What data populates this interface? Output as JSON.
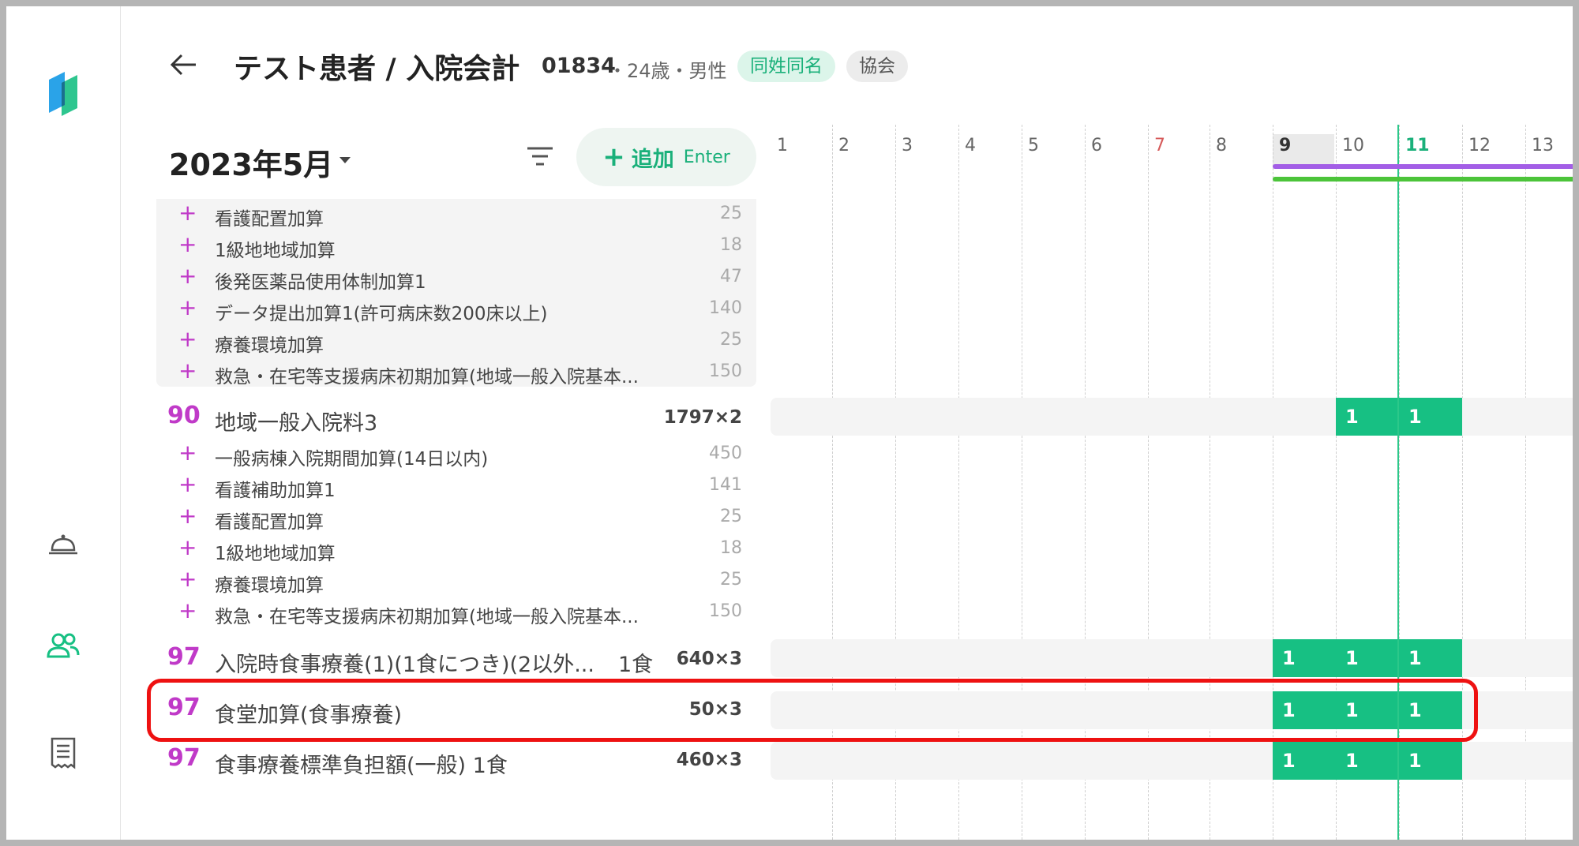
{
  "header": {
    "title": "テスト患者 / 入院会計",
    "patient_id": "01834",
    "patient_meta": "・24歳・男性",
    "badges": [
      "同姓同名",
      "協会"
    ]
  },
  "toolbar": {
    "month": "2023年5月",
    "add_label": "追加",
    "add_key": "Enter"
  },
  "sidebar": {
    "icons": [
      "app-logo-icon",
      "bell-icon",
      "users-icon",
      "receipt-icon"
    ]
  },
  "calendar": {
    "days": [
      "1",
      "2",
      "3",
      "4",
      "5",
      "6",
      "7",
      "8",
      "9",
      "10",
      "11",
      "12",
      "13"
    ],
    "selected_day": "9",
    "today": "11",
    "holiday_day": "7"
  },
  "rows": [
    {
      "type": "sub",
      "plus": "+",
      "name": "看護配置加算",
      "val": "25"
    },
    {
      "type": "sub",
      "plus": "+",
      "name": "1級地地域加算",
      "val": "18"
    },
    {
      "type": "sub",
      "plus": "+",
      "name": "後発医薬品使用体制加算1",
      "val": "47"
    },
    {
      "type": "sub",
      "plus": "+",
      "name": "データ提出加算1(許可病床数200床以上)",
      "val": "140"
    },
    {
      "type": "sub",
      "plus": "+",
      "name": "療養環境加算",
      "val": "25"
    },
    {
      "type": "sub",
      "plus": "+",
      "name": "救急・在宅等支援病床初期加算(地域一般入院基本...",
      "val": "150"
    },
    {
      "type": "main",
      "code": "90",
      "name": "地域一般入院料3",
      "unit": "",
      "val": "1797×2",
      "cells": [
        "1",
        "1"
      ]
    },
    {
      "type": "sub",
      "plus": "+",
      "name": "一般病棟入院期間加算(14日以内)",
      "val": "450"
    },
    {
      "type": "sub",
      "plus": "+",
      "name": "看護補助加算1",
      "val": "141"
    },
    {
      "type": "sub",
      "plus": "+",
      "name": "看護配置加算",
      "val": "25"
    },
    {
      "type": "sub",
      "plus": "+",
      "name": "1級地地域加算",
      "val": "18"
    },
    {
      "type": "sub",
      "plus": "+",
      "name": "療養環境加算",
      "val": "25"
    },
    {
      "type": "sub",
      "plus": "+",
      "name": "救急・在宅等支援病床初期加算(地域一般入院基本...",
      "val": "150"
    },
    {
      "type": "main",
      "code": "97",
      "name": "入院時食事療養(1)(1食につき)(2以外...",
      "unit": "1食",
      "val": "640×3",
      "cells": [
        "1",
        "1",
        "1"
      ]
    },
    {
      "type": "main",
      "code": "97",
      "name": "食堂加算(食事療養)",
      "unit": "",
      "val": "50×3",
      "cells": [
        "1",
        "1",
        "1"
      ]
    },
    {
      "type": "main",
      "code": "97",
      "name": "食事療養標準負担額(一般) 1食",
      "unit": "",
      "val": "460×3",
      "cells": [
        "1",
        "1",
        "1"
      ]
    }
  ],
  "colors": {
    "accent": "#1ab07a",
    "code": "#c03ac8",
    "cell": "#17c083",
    "highlight": "#ee1111"
  }
}
